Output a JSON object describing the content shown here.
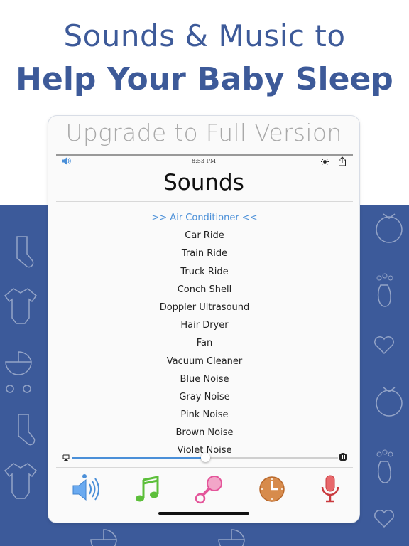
{
  "headline": {
    "line1": "Sounds & Music to",
    "line2": "Help Your Baby Sleep"
  },
  "upgrade_banner": "Upgrade to Full Version",
  "status_bar": {
    "time": "8:53 PM",
    "left_icon": "speaker-icon",
    "right_icons": [
      "brightness-icon",
      "share-icon"
    ]
  },
  "screen_title": "Sounds",
  "sounds": {
    "selected": ">> Air Conditioner <<",
    "items": [
      "Car Ride",
      "Train Ride",
      "Truck Ride",
      "Conch Shell",
      "Doppler Ultrasound",
      "Hair Dryer",
      "Fan",
      "Vacuum Cleaner",
      "Blue Noise",
      "Gray Noise",
      "Pink Noise",
      "Brown Noise",
      "Violet Noise"
    ]
  },
  "player": {
    "progress": 0.5,
    "state_icon": "pause-icon",
    "airplay_icon": "airplay-icon"
  },
  "tabs": [
    {
      "name": "sounds",
      "icon": "speaker-icon",
      "color": "#4a8fd8",
      "active": true
    },
    {
      "name": "music",
      "icon": "music-note-icon",
      "color": "#5cbf3a"
    },
    {
      "name": "rattle",
      "icon": "rattle-icon",
      "color": "#e4559a"
    },
    {
      "name": "timer",
      "icon": "clock-icon",
      "color": "#c97a3a"
    },
    {
      "name": "record",
      "icon": "microphone-icon",
      "color": "#d9454a"
    }
  ],
  "colors": {
    "brand_blue": "#3d5a99",
    "accent": "#4a8fd8"
  }
}
